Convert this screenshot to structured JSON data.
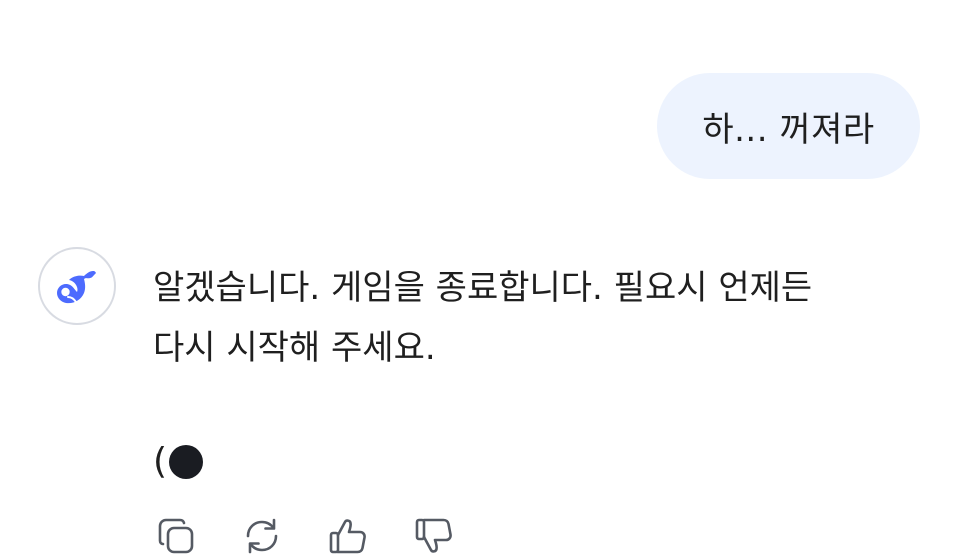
{
  "user_message": {
    "text": "하... 꺼져라"
  },
  "assistant": {
    "avatar_icon": "whale-logo-icon",
    "accent_color": "#4d6bfe",
    "lines": [
      "알겠습니다. 게임을 종료합니다. 필요시 언제든",
      "다시 시작해 주세요."
    ],
    "cursor_text": "("
  },
  "actions": {
    "icons": [
      "copy-icon",
      "regenerate-icon",
      "thumbs-up-icon",
      "thumbs-down-icon"
    ]
  },
  "colors": {
    "user_bubble_bg": "#edf3fe",
    "text": "#1f1f1f",
    "icon_stroke": "#555a63"
  }
}
